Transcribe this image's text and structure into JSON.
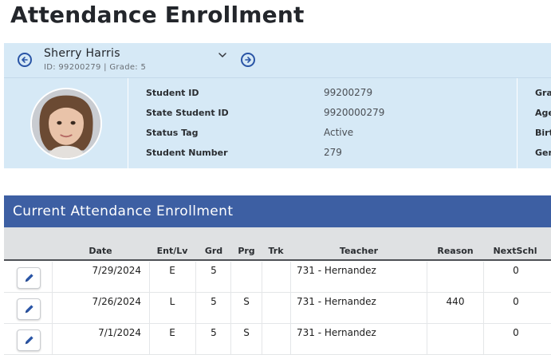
{
  "page": {
    "title": "Attendance Enrollment"
  },
  "student": {
    "name": "Sherry Harris",
    "id_line": "ID: 99200279 |  Grade: 5",
    "prev_icon": "arrow-left-circle-icon",
    "next_icon": "arrow-right-circle-icon",
    "dropdown_icon": "chevron-down-icon"
  },
  "details": {
    "fields": [
      {
        "label": "Student ID",
        "value": "99200279"
      },
      {
        "label": "State Student ID",
        "value": "9920000279"
      },
      {
        "label": "Status Tag",
        "value": "Active"
      },
      {
        "label": "Student Number",
        "value": "279"
      }
    ],
    "side_labels": [
      "Gra",
      "Age",
      "Birt",
      "Gen"
    ]
  },
  "section": {
    "title": "Current Attendance Enrollment"
  },
  "table": {
    "headers": {
      "date": "Date",
      "entlv": "Ent/Lv",
      "grd": "Grd",
      "prg": "Prg",
      "trk": "Trk",
      "teacher": "Teacher",
      "reason": "Reason",
      "nextschl": "NextSchl"
    },
    "rows": [
      {
        "date": "7/29/2024",
        "entlv": "E",
        "grd": "5",
        "prg": "",
        "trk": "",
        "teacher": "731 - Hernandez",
        "reason": "",
        "nextschl": "0"
      },
      {
        "date": "7/26/2024",
        "entlv": "L",
        "grd": "5",
        "prg": "S",
        "trk": "",
        "teacher": "731 - Hernandez",
        "reason": "440",
        "nextschl": "0"
      },
      {
        "date": "7/1/2024",
        "entlv": "E",
        "grd": "5",
        "prg": "S",
        "trk": "",
        "teacher": "731 - Hernandez",
        "reason": "",
        "nextschl": "0"
      }
    ]
  },
  "colors": {
    "accent": "#3d5fa3",
    "panel": "#d6e9f6",
    "icon": "#2a55a6"
  }
}
